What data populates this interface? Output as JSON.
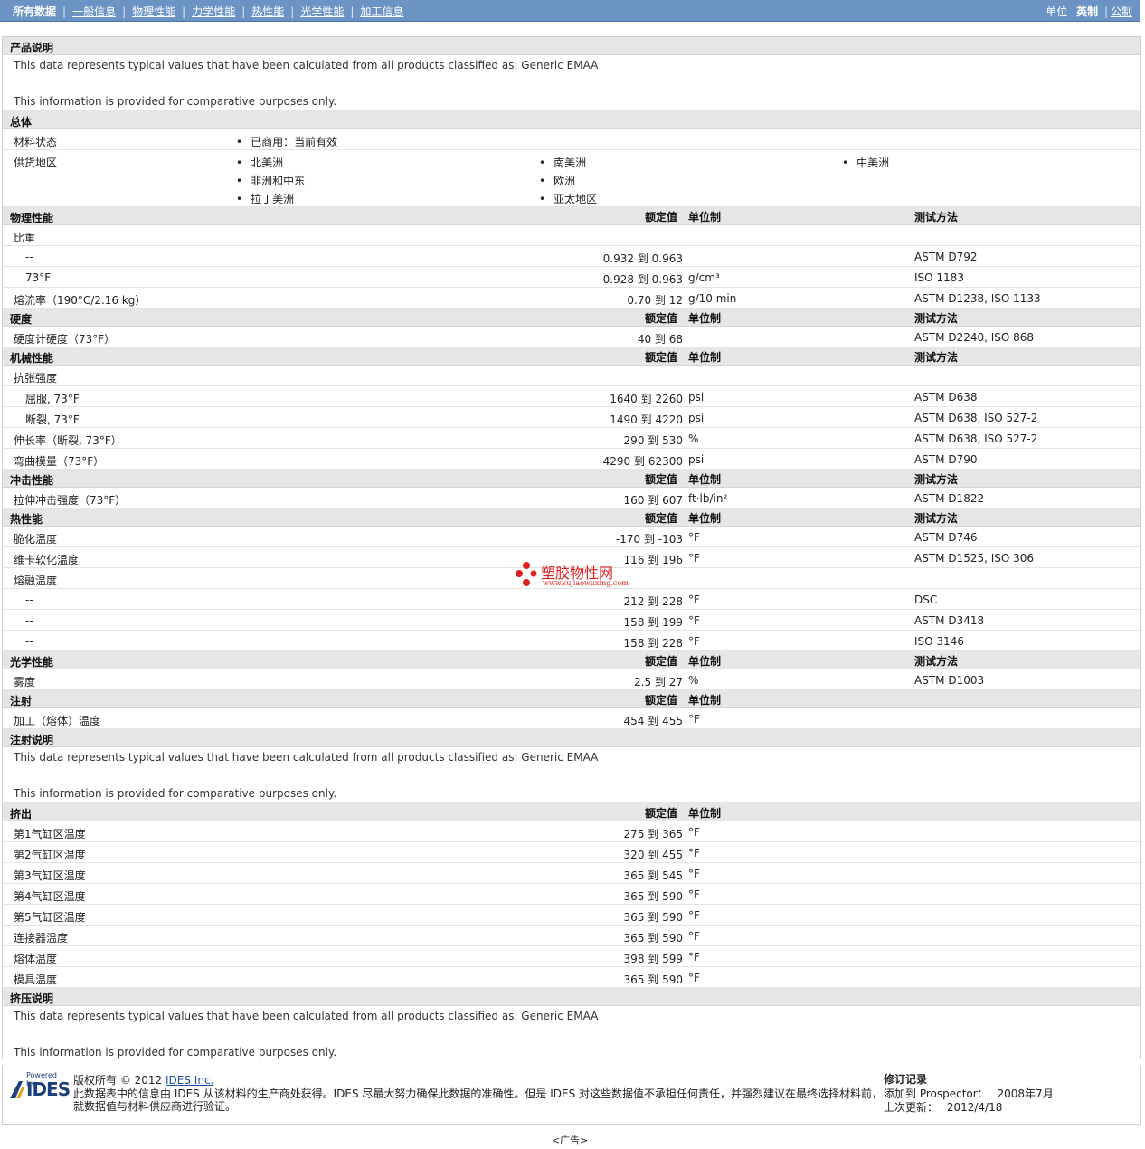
{
  "nav": {
    "items": [
      "所有数据",
      "一般信息",
      "物理性能",
      "力学性能",
      "热性能",
      "光学性能",
      "加工信息"
    ],
    "units_label": "单位",
    "units_selected": "英制",
    "units_other": "公制"
  },
  "product_desc": {
    "title": "产品说明",
    "line1": "This data represents typical values that have been calculated from all products classified as: Generic EMAA",
    "line2": "This information is provided for comparative purposes only."
  },
  "general": {
    "title": "总体",
    "status_label": "材料状态",
    "status_value": "已商用：当前有效",
    "region_label": "供货地区",
    "regions": [
      "北美洲",
      "南美洲",
      "中美洲",
      "非洲和中东",
      "欧洲",
      "拉丁美洲",
      "亚太地区"
    ]
  },
  "col": {
    "value": "额定值",
    "unit": "单位制",
    "method": "测试方法"
  },
  "physical": {
    "title": "物理性能",
    "rows": [
      {
        "label": "比重",
        "value": "",
        "unit": "",
        "method": "",
        "sub": false
      },
      {
        "label": "--",
        "value": "0.932 到  0.963",
        "unit": "",
        "method": "ASTM D792",
        "sub": true
      },
      {
        "label": "73°F",
        "value": "0.928 到  0.963",
        "unit": "g/cm³",
        "method": "ISO 1183",
        "sub": true
      },
      {
        "label": "熔流率（190°C/2.16 kg）",
        "value": "0.70 到  12",
        "unit": "g/10 min",
        "method": "ASTM D1238, ISO 1133",
        "sub": false
      }
    ]
  },
  "hardness": {
    "title": "硬度",
    "rows": [
      {
        "label": "硬度计硬度（73°F）",
        "value": "40 到  68",
        "unit": "",
        "method": "ASTM D2240, ISO 868",
        "sub": false
      }
    ]
  },
  "mechanical": {
    "title": "机械性能",
    "rows": [
      {
        "label": "抗张强度",
        "value": "",
        "unit": "",
        "method": "",
        "sub": false
      },
      {
        "label": "屈服, 73°F",
        "value": "1640 到  2260",
        "unit": "psi",
        "method": "ASTM D638",
        "sub": true
      },
      {
        "label": "断裂, 73°F",
        "value": "1490 到  4220",
        "unit": "psi",
        "method": "ASTM D638, ISO 527-2",
        "sub": true
      },
      {
        "label": "伸长率（断裂, 73°F）",
        "value": "290 到  530",
        "unit": "%",
        "method": "ASTM D638, ISO 527-2",
        "sub": false
      },
      {
        "label": "弯曲模量（73°F）",
        "value": "4290 到  62300",
        "unit": "psi",
        "method": "ASTM D790",
        "sub": false
      }
    ]
  },
  "impact": {
    "title": "冲击性能",
    "rows": [
      {
        "label": "拉伸冲击强度（73°F）",
        "value": "160 到  607",
        "unit": "ft·lb/in²",
        "method": "ASTM D1822",
        "sub": false
      }
    ]
  },
  "thermal": {
    "title": "热性能",
    "rows": [
      {
        "label": "脆化温度",
        "value": "-170 到  -103",
        "unit": "°F",
        "method": "ASTM D746",
        "sub": false
      },
      {
        "label": "维卡软化温度",
        "value": "116 到  196",
        "unit": "°F",
        "method": "ASTM D1525, ISO 306",
        "sub": false
      },
      {
        "label": "熔融温度",
        "value": "",
        "unit": "",
        "method": "",
        "sub": false
      },
      {
        "label": "--",
        "value": "212 到  228",
        "unit": "°F",
        "method": "DSC",
        "sub": true
      },
      {
        "label": "--",
        "value": "158 到  199",
        "unit": "°F",
        "method": "ASTM D3418",
        "sub": true
      },
      {
        "label": "--",
        "value": "158 到  228",
        "unit": "°F",
        "method": "ISO 3146",
        "sub": true
      }
    ]
  },
  "optical": {
    "title": "光学性能",
    "rows": [
      {
        "label": "雾度",
        "value": "2.5 到  27",
        "unit": "%",
        "method": "ASTM D1003",
        "sub": false
      }
    ]
  },
  "injection": {
    "title": "注射",
    "rows": [
      {
        "label": "加工（熔体）温度",
        "value": "454 到  455",
        "unit": "°F",
        "method": "",
        "sub": false
      }
    ]
  },
  "injection_note": {
    "title": "注射说明",
    "line1": "This data represents typical values that have been calculated from all products classified as: Generic EMAA",
    "line2": "This information is provided for comparative purposes only."
  },
  "extrusion": {
    "title": "挤出",
    "rows": [
      {
        "label": "第1气缸区温度",
        "value": "275 到  365",
        "unit": "°F",
        "method": "",
        "sub": false
      },
      {
        "label": "第2气缸区温度",
        "value": "320 到  455",
        "unit": "°F",
        "method": "",
        "sub": false
      },
      {
        "label": "第3气缸区温度",
        "value": "365 到  545",
        "unit": "°F",
        "method": "",
        "sub": false
      },
      {
        "label": "第4气缸区温度",
        "value": "365 到  590",
        "unit": "°F",
        "method": "",
        "sub": false
      },
      {
        "label": "第5气缸区温度",
        "value": "365 到  590",
        "unit": "°F",
        "method": "",
        "sub": false
      },
      {
        "label": "连接器温度",
        "value": "365 到  590",
        "unit": "°F",
        "method": "",
        "sub": false
      },
      {
        "label": "熔体温度",
        "value": "398 到  599",
        "unit": "°F",
        "method": "",
        "sub": false
      },
      {
        "label": "模具温度",
        "value": "365 到  590",
        "unit": "°F",
        "method": "",
        "sub": false
      }
    ]
  },
  "extrusion_note": {
    "title": "挤压说明",
    "line1": "This data represents typical values that have been calculated from all products classified as: Generic EMAA",
    "line2": "This information is provided for comparative purposes only."
  },
  "footer": {
    "logo_top": "Powered by",
    "logo_text": "IDES",
    "copyright_prefix": "版权所有 © 2012",
    "copyright_link": "IDES Inc.",
    "disclaimer1": "此数据表中的信息由 IDES 从该材料的生产商处获得。IDES 尽最大努力确保此数据的准确性。但是 IDES 对这些数据值不承担任何责任，并强烈建议在最终选择材料前，",
    "disclaimer2": "就数据值与材料供应商进行验证。",
    "rev_title": "修订记录",
    "added_label": "添加到 Prospector：",
    "added_value": "2008年7月",
    "updated_label": "上次更新：",
    "updated_value": "2012/4/18"
  },
  "ad_label": "<广告>",
  "watermark": {
    "cn": "塑胶物性网",
    "url": "www.sujiaowuxing.com"
  }
}
